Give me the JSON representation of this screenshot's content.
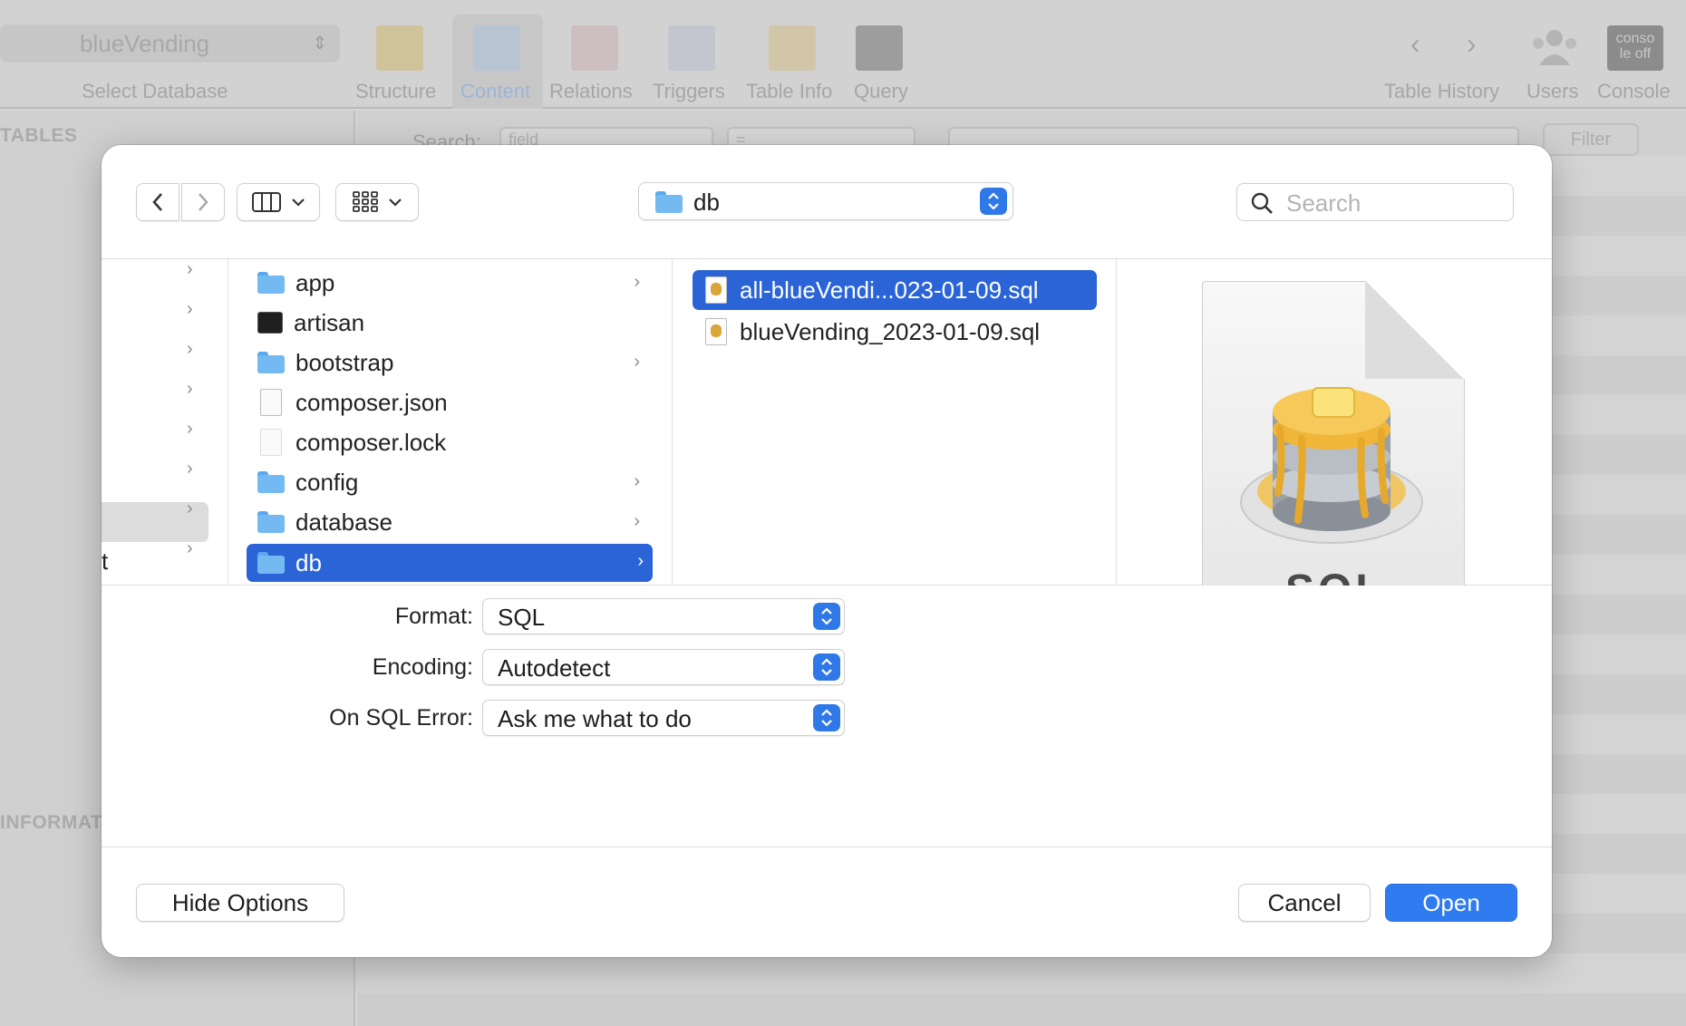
{
  "background_app": {
    "database": "blueVending",
    "select_database_label": "Select Database",
    "toolbar": [
      {
        "label": "Structure",
        "icon": "structure-icon"
      },
      {
        "label": "Content",
        "icon": "content-icon"
      },
      {
        "label": "Relations",
        "icon": "relations-icon"
      },
      {
        "label": "Triggers",
        "icon": "triggers-icon"
      },
      {
        "label": "Table Info",
        "icon": "table-info-icon"
      },
      {
        "label": "Query",
        "icon": "query-icon"
      }
    ],
    "right_toolbar": [
      {
        "label": "Table History",
        "icon": "history-nav-icon"
      },
      {
        "label": "Users",
        "icon": "users-icon"
      },
      {
        "label": "Console",
        "icon": "console-icon"
      }
    ],
    "console_icon_text": "conso le off",
    "tables_header": "TABLES",
    "information_header": "INFORMAT",
    "search_label": "Search:",
    "search_field": "field",
    "search_operator": "=",
    "filter_button": "Filter"
  },
  "dialog": {
    "path": "db",
    "search_placeholder": "Search",
    "column2": [
      {
        "name": "app",
        "kind": "folder",
        "has_children": true
      },
      {
        "name": "artisan",
        "kind": "terminal",
        "has_children": false
      },
      {
        "name": "bootstrap",
        "kind": "folder",
        "has_children": true
      },
      {
        "name": "composer.json",
        "kind": "doc",
        "has_children": false
      },
      {
        "name": "composer.lock",
        "kind": "doc",
        "has_children": false
      },
      {
        "name": "config",
        "kind": "folder",
        "has_children": true
      },
      {
        "name": "database",
        "kind": "folder",
        "has_children": true
      },
      {
        "name": "db",
        "kind": "folder",
        "has_children": true,
        "selected": true
      }
    ],
    "column1_partial_text": "t",
    "column3": [
      {
        "name": "all-blueVendi...023-01-09.sql",
        "selected": true
      },
      {
        "name": "blueVending_2023-01-09.sql",
        "selected": false
      }
    ],
    "preview_text": "SQL",
    "options": {
      "format_label": "Format:",
      "format_value": "SQL",
      "encoding_label": "Encoding:",
      "encoding_value": "Autodetect",
      "error_label": "On SQL Error:",
      "error_value": "Ask me what to do"
    },
    "buttons": {
      "hide_options": "Hide Options",
      "cancel": "Cancel",
      "open": "Open"
    },
    "colors": {
      "accent": "#2f7bf0",
      "selection": "#2a64d6",
      "folder": "#74baf2"
    }
  }
}
